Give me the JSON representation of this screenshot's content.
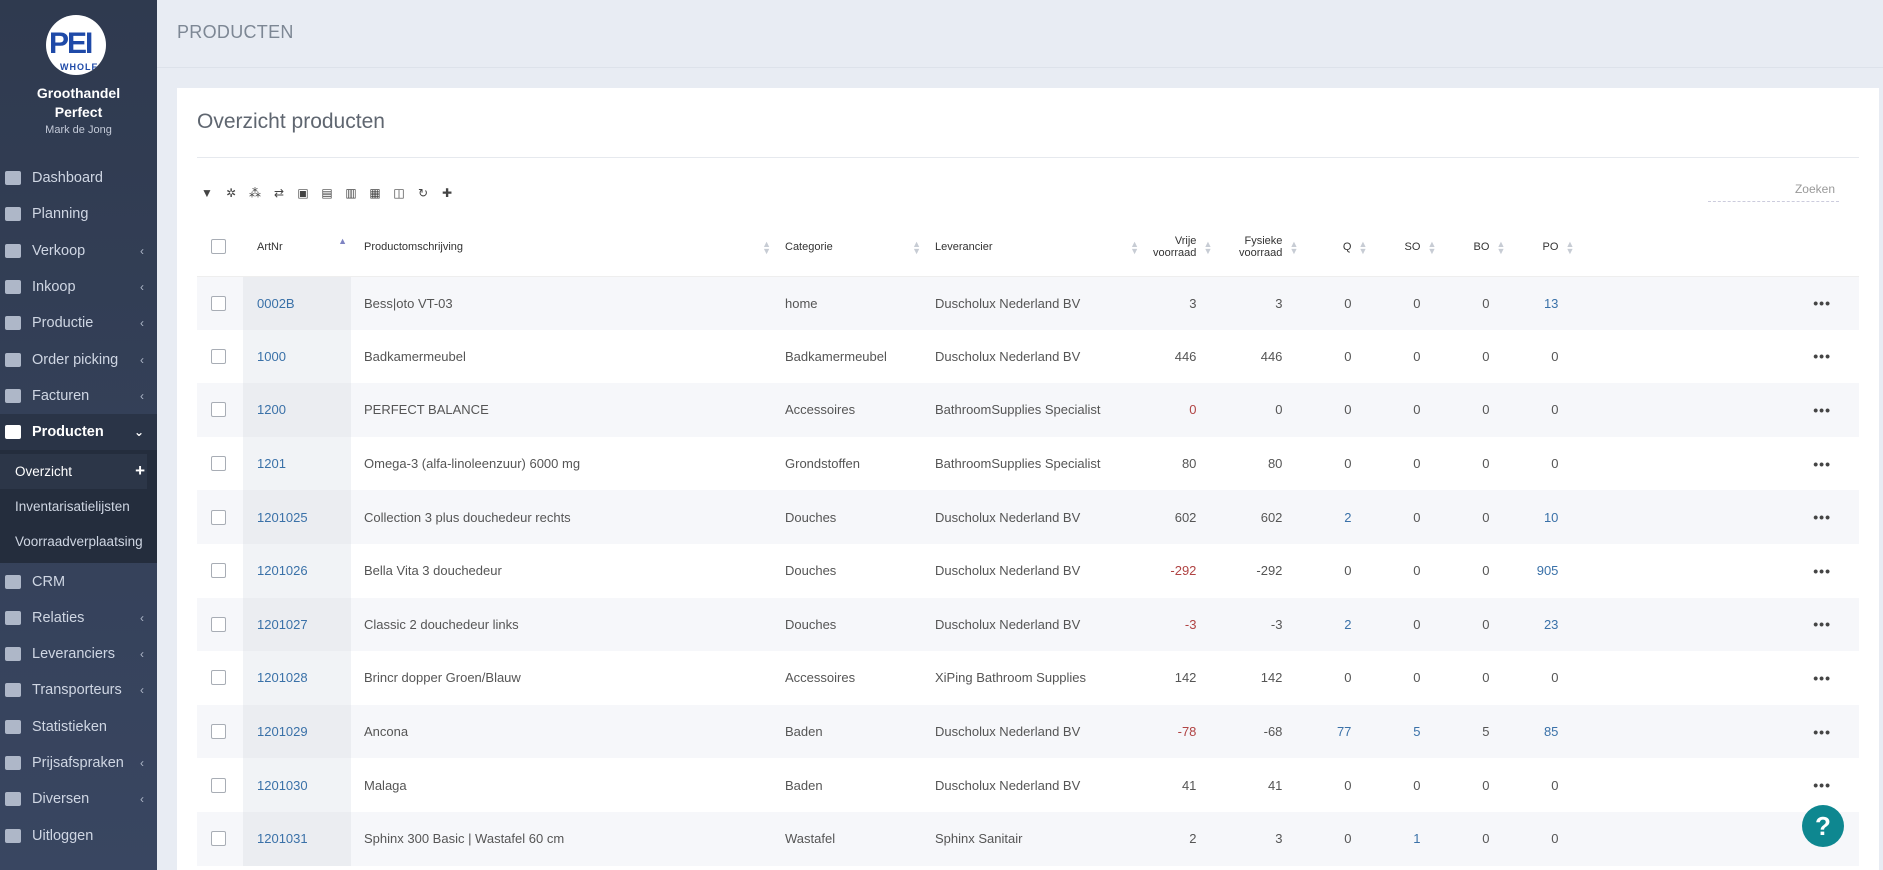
{
  "sidebar": {
    "logo_text": "PEI",
    "logo_sub": "WHOLE",
    "company_line1": "Groothandel",
    "company_line2": "Perfect",
    "user": "Mark de Jong",
    "items": [
      {
        "label": "Dashboard",
        "icon": "home-icon",
        "chevron": ""
      },
      {
        "label": "Planning",
        "icon": "calendar-icon",
        "chevron": ""
      },
      {
        "label": "Verkoop",
        "icon": "document-icon",
        "chevron": "‹"
      },
      {
        "label": "Inkoop",
        "icon": "arrow-in-icon",
        "chevron": "‹"
      },
      {
        "label": "Productie",
        "icon": "wrench-icon",
        "chevron": "‹"
      },
      {
        "label": "Order picking",
        "icon": "barcode-icon",
        "chevron": "‹"
      },
      {
        "label": "Facturen",
        "icon": "money-icon",
        "chevron": "‹"
      },
      {
        "label": "Producten",
        "icon": "cubes-icon",
        "chevron": "⌄"
      }
    ],
    "subitems": [
      {
        "label": "Overzicht",
        "plus": "+"
      },
      {
        "label": "Inventarisatielijsten"
      },
      {
        "label": "Voorraadverplaatsing"
      }
    ],
    "items2": [
      {
        "label": "CRM",
        "icon": "server-icon",
        "chevron": ""
      },
      {
        "label": "Relaties",
        "icon": "users-icon",
        "chevron": "‹"
      },
      {
        "label": "Leveranciers",
        "icon": "bus-icon",
        "chevron": "‹"
      },
      {
        "label": "Transporteurs",
        "icon": "truck-icon",
        "chevron": "‹"
      },
      {
        "label": "Statistieken",
        "icon": "bar-chart-icon",
        "chevron": ""
      },
      {
        "label": "Prijsafspraken",
        "icon": "tag-icon",
        "chevron": "‹"
      },
      {
        "label": "Diversen",
        "icon": "cogs-icon",
        "chevron": "‹"
      },
      {
        "label": "Uitloggen",
        "icon": "sign-out-icon",
        "chevron": ""
      }
    ]
  },
  "topbar": {
    "title": "PRODUCTEN"
  },
  "card": {
    "title": "Overzicht producten",
    "search_placeholder": "Zoeken"
  },
  "toolbar": [
    "filter-icon",
    "gear-icon",
    "cubes-icon",
    "exchange-icon",
    "excel-icon",
    "file-icon",
    "pdf-icon",
    "file-text-icon",
    "columns-icon",
    "refresh-icon",
    "plus-icon"
  ],
  "table": {
    "headers": {
      "artnr": "ArtNr",
      "desc": "Productomschrijving",
      "cat": "Categorie",
      "lev": "Leverancier",
      "vrije1": "Vrije",
      "vrije2": "voorraad",
      "fys1": "Fysieke",
      "fys2": "voorraad",
      "q": "Q",
      "so": "SO",
      "bo": "BO",
      "po": "PO"
    },
    "rows": [
      {
        "artnr": "0002B",
        "desc": "Bess|oto VT-03",
        "cat": "home",
        "lev": "Duscholux Nederland BV",
        "vrije": "3",
        "fys": "3",
        "q": "0",
        "so": "0",
        "bo": "0",
        "po": "13",
        "vrije_red": false,
        "q_blue": false,
        "so_blue": false,
        "po_blue": true
      },
      {
        "artnr": "1000",
        "desc": "Badkamermeubel",
        "cat": "Badkamermeubel",
        "lev": "Duscholux Nederland BV",
        "vrije": "446",
        "fys": "446",
        "q": "0",
        "so": "0",
        "bo": "0",
        "po": "0",
        "vrije_red": false,
        "q_blue": false,
        "so_blue": false,
        "po_blue": false
      },
      {
        "artnr": "1200",
        "desc": "PERFECT BALANCE",
        "cat": "Accessoires",
        "lev": "BathroomSupplies Specialist",
        "vrije": "0",
        "fys": "0",
        "q": "0",
        "so": "0",
        "bo": "0",
        "po": "0",
        "vrije_red": true,
        "q_blue": false,
        "so_blue": false,
        "po_blue": false
      },
      {
        "artnr": "1201",
        "desc": "Omega-3 (alfa-linoleenzuur) 6000 mg",
        "cat": "Grondstoffen",
        "lev": "BathroomSupplies Specialist",
        "vrije": "80",
        "fys": "80",
        "q": "0",
        "so": "0",
        "bo": "0",
        "po": "0",
        "vrije_red": false,
        "q_blue": false,
        "so_blue": false,
        "po_blue": false
      },
      {
        "artnr": "1201025",
        "desc": "Collection 3 plus douchedeur rechts",
        "cat": "Douches",
        "lev": "Duscholux Nederland BV",
        "vrije": "602",
        "fys": "602",
        "q": "2",
        "so": "0",
        "bo": "0",
        "po": "10",
        "vrije_red": false,
        "q_blue": true,
        "so_blue": false,
        "po_blue": true
      },
      {
        "artnr": "1201026",
        "desc": "Bella Vita 3 douchedeur",
        "cat": "Douches",
        "lev": "Duscholux Nederland BV",
        "vrije": "-292",
        "fys": "-292",
        "q": "0",
        "so": "0",
        "bo": "0",
        "po": "905",
        "vrije_red": true,
        "q_blue": false,
        "so_blue": false,
        "po_blue": true
      },
      {
        "artnr": "1201027",
        "desc": "Classic 2 douchedeur links",
        "cat": "Douches",
        "lev": "Duscholux Nederland BV",
        "vrije": "-3",
        "fys": "-3",
        "q": "2",
        "so": "0",
        "bo": "0",
        "po": "23",
        "vrije_red": true,
        "q_blue": true,
        "so_blue": false,
        "po_blue": true
      },
      {
        "artnr": "1201028",
        "desc": "Brincr dopper Groen/Blauw",
        "cat": "Accessoires",
        "lev": "XiPing Bathroom Supplies",
        "vrije": "142",
        "fys": "142",
        "q": "0",
        "so": "0",
        "bo": "0",
        "po": "0",
        "vrije_red": false,
        "q_blue": false,
        "so_blue": false,
        "po_blue": false
      },
      {
        "artnr": "1201029",
        "desc": "Ancona",
        "cat": "Baden",
        "lev": "Duscholux Nederland BV",
        "vrije": "-78",
        "fys": "-68",
        "q": "77",
        "so": "5",
        "bo": "5",
        "po": "85",
        "vrije_red": true,
        "q_blue": true,
        "so_blue": true,
        "po_blue": true
      },
      {
        "artnr": "1201030",
        "desc": "Malaga",
        "cat": "Baden",
        "lev": "Duscholux Nederland BV",
        "vrije": "41",
        "fys": "41",
        "q": "0",
        "so": "0",
        "bo": "0",
        "po": "0",
        "vrije_red": false,
        "q_blue": false,
        "so_blue": false,
        "po_blue": false
      },
      {
        "artnr": "1201031",
        "desc": "Sphinx 300 Basic | Wastafel 60 cm",
        "cat": "Wastafel",
        "lev": "Sphinx Sanitair",
        "vrije": "2",
        "fys": "3",
        "q": "0",
        "so": "1",
        "bo": "0",
        "po": "0",
        "vrije_red": false,
        "q_blue": false,
        "so_blue": true,
        "po_blue": false
      }
    ],
    "row_menu": "•••"
  },
  "help_button": "?",
  "colors": {
    "sidebar": "#2f3a4f",
    "link": "#3a71a8",
    "negative": "#b04343",
    "help": "#0e8790"
  }
}
